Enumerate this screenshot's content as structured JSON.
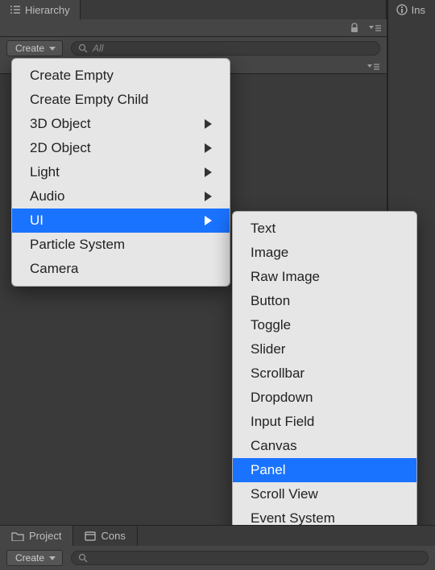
{
  "tabs": {
    "hierarchy": "Hierarchy",
    "inspector": "Ins"
  },
  "toolbar": {
    "create_label": "Create",
    "search_placeholder": "All"
  },
  "context_menu": {
    "items": [
      {
        "label": "Create Empty",
        "submenu": false
      },
      {
        "label": "Create Empty Child",
        "submenu": false
      },
      {
        "label": "3D Object",
        "submenu": true
      },
      {
        "label": "2D Object",
        "submenu": true
      },
      {
        "label": "Light",
        "submenu": true
      },
      {
        "label": "Audio",
        "submenu": true
      },
      {
        "label": "UI",
        "submenu": true,
        "highlighted": true
      },
      {
        "label": "Particle System",
        "submenu": false
      },
      {
        "label": "Camera",
        "submenu": false
      }
    ]
  },
  "ui_submenu": {
    "items": [
      {
        "label": "Text"
      },
      {
        "label": "Image"
      },
      {
        "label": "Raw Image"
      },
      {
        "label": "Button"
      },
      {
        "label": "Toggle"
      },
      {
        "label": "Slider"
      },
      {
        "label": "Scrollbar"
      },
      {
        "label": "Dropdown"
      },
      {
        "label": "Input Field"
      },
      {
        "label": "Canvas"
      },
      {
        "label": "Panel",
        "highlighted": true
      },
      {
        "label": "Scroll View"
      },
      {
        "label": "Event System"
      }
    ]
  },
  "bottom_tabs": {
    "project": "Project",
    "console": "Cons"
  },
  "bottom_toolbar": {
    "create_label": "Create"
  }
}
